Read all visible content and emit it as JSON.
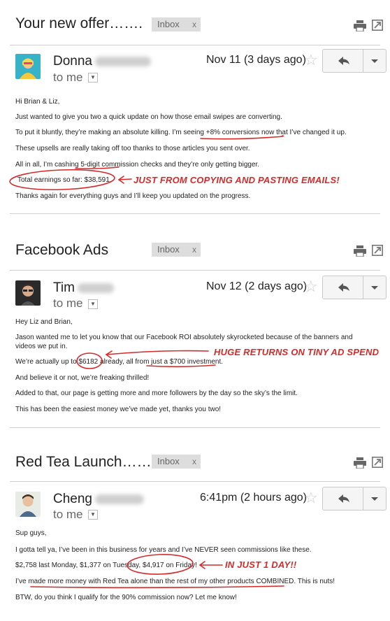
{
  "emails": [
    {
      "subject": "Your new offer…….",
      "tag": "Inbox",
      "tag_close": "x",
      "sender": "Donna",
      "to": "to me",
      "date": "Nov 11 (3 days ago)",
      "lines": [
        "Hi Brian & Liz,",
        "Just wanted to give you two a quick update on how those email swipes are converting.",
        "To put it bluntly, they’re making an absolute killing. I’m seeing +8% conversions now that I’ve changed it up.",
        "These upsells are really taking off too thanks to those articles you sent over.",
        "All in all, I’m cashing 5-digit commission checks and they’re only getting bigger.",
        "Total earnings so far: $38,591.",
        "Thanks again for everything guys and I’ll keep you updated on the progress."
      ],
      "annotation": "JUST FROM COPYING AND PASTING EMAILS!"
    },
    {
      "subject": "Facebook Ads",
      "tag": "Inbox",
      "tag_close": "x",
      "sender": "Tim",
      "to": "to me",
      "date": "Nov 12 (2 days ago)",
      "lines": [
        "Hey Liz and Brian,",
        "Jason wanted me to let you know that our Facebook ROI absolutely skyrocketed because of the banners and",
        "videos we put in.",
        "We’re actually up to $6182 already, all from just a $700 investment.",
        "And believe it or not, we’re freaking thrilled!",
        "Added to that, our page is getting more and more followers by the day so the sky’s the limit.",
        "This has been the easiest money we’ve made yet, thanks you two!"
      ],
      "annotation": "HUGE RETURNS ON TINY AD SPEND"
    },
    {
      "subject": "Red Tea Launch……",
      "tag": "Inbox",
      "tag_close": "x",
      "sender": "Cheng",
      "to": "to me",
      "date": "6:41pm (2 hours ago)",
      "lines": [
        "Sup guys,",
        "I gotta tell ya, I’ve been in this business for years and I’ve NEVER seen commissions like these.",
        "$2,758 last Monday, $1,377 on Tuesday, $4,917 on Friday!",
        "I’ve made more money with Red Tea alone than the rest of my other products COMBINED. This is nuts!",
        "BTW, do you think I qualify for the 90% commission now? Let me know!"
      ],
      "annotation": "IN JUST 1 DAY!!"
    }
  ],
  "colors": {
    "accent": "#d42a2a",
    "tag_bg": "#dddddd",
    "divider": "#cfcfcf"
  },
  "icons": [
    "print-icon",
    "new-window-icon",
    "star-icon",
    "reply-icon",
    "more-caret-icon",
    "avatar"
  ]
}
